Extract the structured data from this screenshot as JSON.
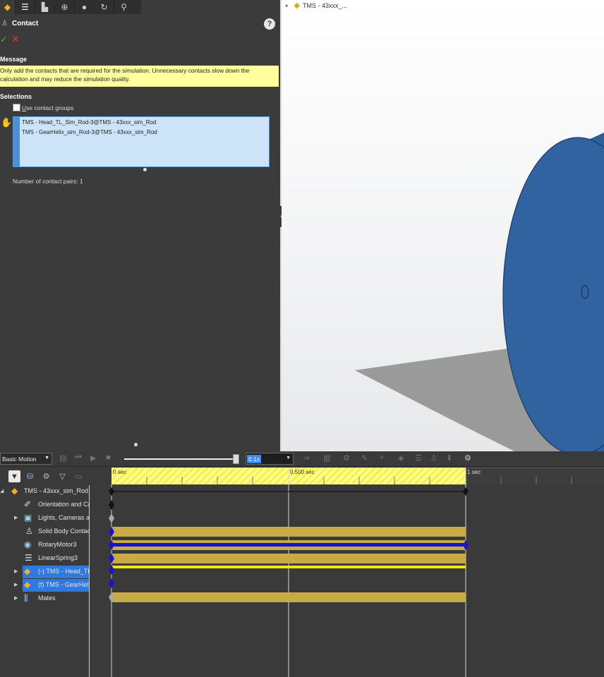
{
  "property_manager": {
    "title": "Contact",
    "help_symbol": "?",
    "message_header": "Message",
    "message_line1": "Only add the contacts that are required for the simulation. Unnecessary contacts slow down the",
    "message_line2": "calculation and may reduce the simulation quality.",
    "selections_header": "Selections",
    "use_contact_groups_label": "Use contact groups",
    "selection_items": [
      "TMS - Head_TL_Sim_Rod-3@TMS - 43xxx_sim_Rod",
      "TMS - GearHelix_sim_Rod-3@TMS - 43xxx_sim_Rod"
    ],
    "pairs_label": "Number of contact pairs: 1"
  },
  "viewport": {
    "tree_flyout_label": "TMS - 43xxx_..."
  },
  "motion_study": {
    "study_type": "Basic Motion",
    "playback_speed": "0.1x",
    "time_labels": [
      "0 sec",
      "0.500 sec",
      "1 sec"
    ],
    "tree": [
      {
        "label": "TMS - 43xxx_sim_Rod",
        "icon": "assembly-icon"
      },
      {
        "label": "Orientation and Camera Views",
        "icon": "camera-views-icon"
      },
      {
        "label": "Lights, Cameras and Scene",
        "icon": "lights-icon"
      },
      {
        "label": "Solid Body Contact",
        "icon": "solid-body-contact-icon"
      },
      {
        "label": "RotaryMotor3",
        "icon": "rotary-motor-icon"
      },
      {
        "label": "LinearSpring3",
        "icon": "linear-spring-icon"
      },
      {
        "label": "(-) TMS - Head_TL_Sim_Rod",
        "icon": "part-icon"
      },
      {
        "label": "(f) TMS - GearHelix_sim_Rod",
        "icon": "part-icon"
      },
      {
        "label": "Mates",
        "icon": "mates-icon"
      }
    ]
  },
  "colors": {
    "model_blue": "#2f5d97",
    "timeline_bar": "#c9aa45",
    "motor_bar": "#1414d2",
    "selection_blue": "#2f7ae0",
    "scale_yellow": "#f7f36a"
  }
}
